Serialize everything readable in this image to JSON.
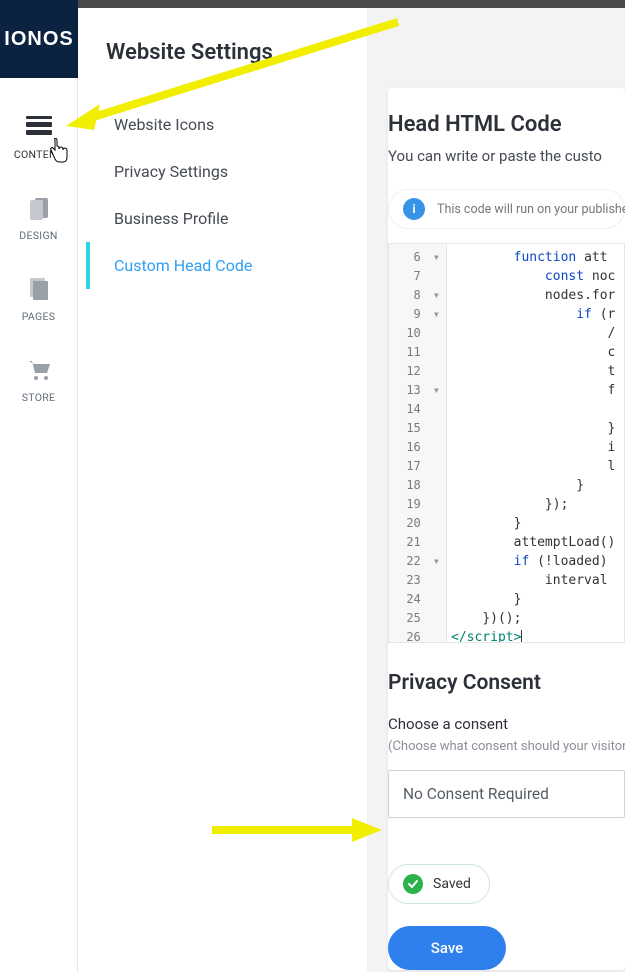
{
  "logo": {
    "text": "IONOS"
  },
  "rail": {
    "items": [
      {
        "label": "CONTENT"
      },
      {
        "label": "DESIGN"
      },
      {
        "label": "PAGES"
      },
      {
        "label": "STORE"
      }
    ]
  },
  "sidebar": {
    "title": "Website Settings",
    "items": [
      {
        "label": "Website Icons"
      },
      {
        "label": "Privacy Settings"
      },
      {
        "label": "Business Profile"
      },
      {
        "label": "Custom Head Code"
      }
    ]
  },
  "main": {
    "title": "Head HTML Code",
    "subtitle": "You can write or paste the custo",
    "info_text": "This code will run on your publishe"
  },
  "code": {
    "lines": [
      {
        "n": 6,
        "fold": "▾",
        "indent": 8,
        "tokens": [
          {
            "t": "function ",
            "c": "kw"
          },
          {
            "t": "att"
          }
        ]
      },
      {
        "n": 7,
        "fold": "",
        "indent": 12,
        "tokens": [
          {
            "t": "const ",
            "c": "kw"
          },
          {
            "t": "noc"
          }
        ]
      },
      {
        "n": 8,
        "fold": "▾",
        "indent": 12,
        "tokens": [
          {
            "t": "nodes.for"
          }
        ]
      },
      {
        "n": 9,
        "fold": "▾",
        "indent": 16,
        "tokens": [
          {
            "t": "if ",
            "c": "kw"
          },
          {
            "t": "(r"
          }
        ]
      },
      {
        "n": 10,
        "fold": "",
        "indent": 20,
        "tokens": [
          {
            "t": "/"
          }
        ]
      },
      {
        "n": 11,
        "fold": "",
        "indent": 20,
        "tokens": [
          {
            "t": "c"
          }
        ]
      },
      {
        "n": 12,
        "fold": "",
        "indent": 20,
        "tokens": [
          {
            "t": "t"
          }
        ]
      },
      {
        "n": 13,
        "fold": "▾",
        "indent": 20,
        "tokens": [
          {
            "t": "f"
          }
        ]
      },
      {
        "n": 14,
        "fold": "",
        "indent": 20,
        "tokens": []
      },
      {
        "n": 15,
        "fold": "",
        "indent": 20,
        "tokens": [
          {
            "t": "}"
          }
        ]
      },
      {
        "n": 16,
        "fold": "",
        "indent": 20,
        "tokens": [
          {
            "t": "i"
          }
        ]
      },
      {
        "n": 17,
        "fold": "",
        "indent": 20,
        "tokens": [
          {
            "t": "l"
          }
        ]
      },
      {
        "n": 18,
        "fold": "",
        "indent": 16,
        "tokens": [
          {
            "t": "}"
          }
        ]
      },
      {
        "n": 19,
        "fold": "",
        "indent": 12,
        "tokens": [
          {
            "t": "});"
          }
        ]
      },
      {
        "n": 20,
        "fold": "",
        "indent": 8,
        "tokens": [
          {
            "t": "}"
          }
        ]
      },
      {
        "n": 21,
        "fold": "",
        "indent": 8,
        "tokens": [
          {
            "t": "attemptLoad()"
          }
        ]
      },
      {
        "n": 22,
        "fold": "▾",
        "indent": 8,
        "tokens": [
          {
            "t": "if ",
            "c": "kw"
          },
          {
            "t": "(!loaded)"
          }
        ]
      },
      {
        "n": 23,
        "fold": "",
        "indent": 12,
        "tokens": [
          {
            "t": "interval"
          }
        ]
      },
      {
        "n": 24,
        "fold": "",
        "indent": 8,
        "tokens": [
          {
            "t": "}"
          }
        ]
      },
      {
        "n": 25,
        "fold": "",
        "indent": 4,
        "tokens": [
          {
            "t": "})();"
          }
        ]
      },
      {
        "n": 26,
        "fold": "",
        "indent": 0,
        "tokens": [
          {
            "t": "</script",
            "c": "tag"
          },
          {
            "t": ">",
            "c": "tag",
            "cursor": true
          }
        ]
      }
    ]
  },
  "privacy": {
    "title": "Privacy Consent",
    "label": "Choose a consent",
    "hint": "(Choose what consent should your visitor g",
    "select_value": "No Consent Required"
  },
  "status": {
    "saved": "Saved",
    "save_btn": "Save"
  },
  "info_glyph": {
    "char": "i"
  }
}
